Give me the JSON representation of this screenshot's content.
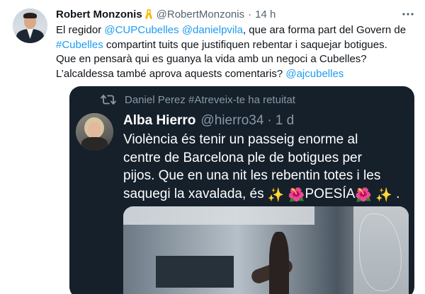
{
  "tweet": {
    "author_name": "Robert Monzonis",
    "author_handle": "@RobertMonzonis",
    "separator": "·",
    "time": "14 h",
    "body_lines": [
      [
        {
          "t": "El regidor ",
          "link": false
        },
        {
          "t": "@CUPCubelles",
          "link": true
        },
        {
          "t": " ",
          "link": false
        },
        {
          "t": "@danielpvila",
          "link": true
        },
        {
          "t": ", que ara forma part del Govern de",
          "link": false
        }
      ],
      [
        {
          "t": "#Cubelles",
          "link": true
        },
        {
          "t": " compartint tuits que justifiquen rebentar i saquejar botigues.",
          "link": false
        }
      ],
      [
        {
          "t": "Que en pensarà qui es guanya la vida amb un negoci a Cubelles?",
          "link": false
        }
      ],
      [
        {
          "t": "L’alcaldessa també aprova aquests comentaris? ",
          "link": false
        },
        {
          "t": "@ajcubelles",
          "link": true
        }
      ]
    ],
    "colors": {
      "link": "#1d9bf0",
      "ribbon": "#f5b800",
      "card_bg": "#15202b"
    },
    "icons": [
      "yellow-ribbon-icon",
      "more-options-icon",
      "retweet-icon"
    ]
  },
  "embedded": {
    "retweet_label": "Daniel Perez #Atreveix-te ha retuitat",
    "author_name": "Alba Hierro",
    "author_handle": "@hierro34",
    "separator": "·",
    "time": "1 d",
    "text_lines": [
      "Violència és tenir un passeig enorme al",
      "centre de Barcelona ple de botigues per",
      "pijos. Que en una nit les rebentin totes i les"
    ],
    "last_line_prefix": "saquegi la xavalada, és ",
    "last_line_word": "POESÍA",
    "last_line_suffix": " .",
    "emoji": {
      "sparkles": "✨",
      "hibiscus": "🌺"
    }
  }
}
